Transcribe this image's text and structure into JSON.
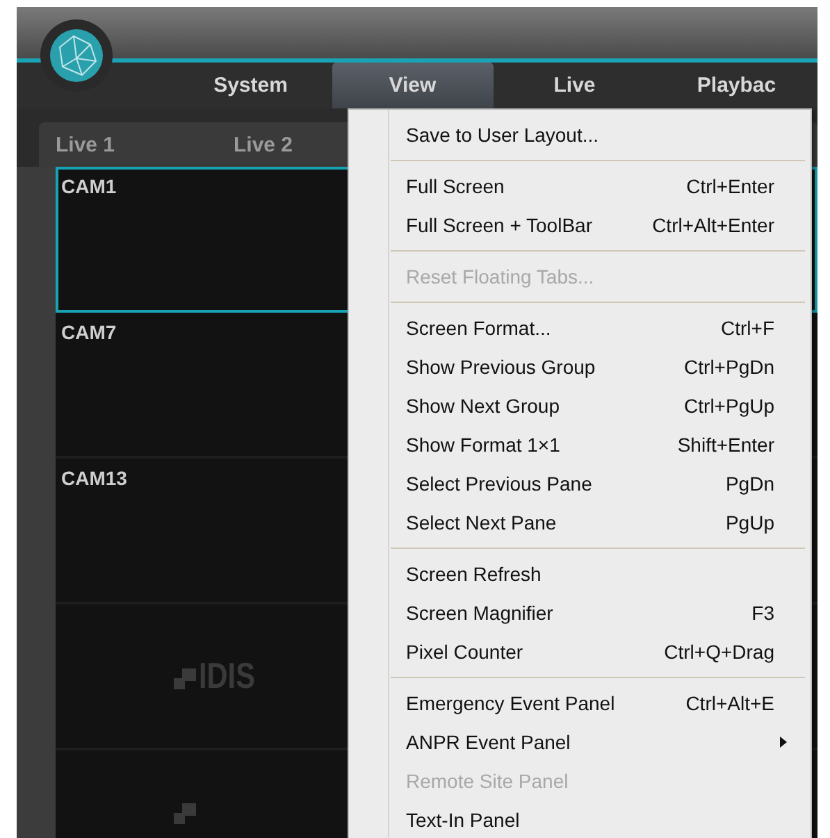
{
  "menubar": [
    {
      "label": "System",
      "selected": false
    },
    {
      "label": "View",
      "selected": true
    },
    {
      "label": "Live",
      "selected": false
    },
    {
      "label": "Playbac",
      "selected": false
    }
  ],
  "live_tabs": [
    {
      "label": "Live 1",
      "selected": false
    },
    {
      "label": "Live 2",
      "selected": false
    }
  ],
  "panes": [
    {
      "kind": "camera",
      "label": "CAM1",
      "selected": true
    },
    {
      "kind": "camera",
      "label": "CAM7",
      "selected": false
    },
    {
      "kind": "camera",
      "label": "CAM13",
      "selected": false
    },
    {
      "kind": "logo",
      "label": "IDIS",
      "selected": false
    },
    {
      "kind": "logo",
      "selected": false
    }
  ],
  "view_menu": [
    {
      "kind": "item",
      "label": "Save to User Layout...",
      "disabled": false
    },
    {
      "kind": "separator"
    },
    {
      "kind": "item",
      "label": "Full Screen",
      "shortcut": "Ctrl+Enter",
      "disabled": false
    },
    {
      "kind": "item",
      "label": "Full Screen + ToolBar",
      "shortcut": "Ctrl+Alt+Enter",
      "disabled": false
    },
    {
      "kind": "separator"
    },
    {
      "kind": "item",
      "label": "Reset Floating Tabs...",
      "disabled": true
    },
    {
      "kind": "separator"
    },
    {
      "kind": "item",
      "label": "Screen Format...",
      "shortcut": "Ctrl+F",
      "disabled": false
    },
    {
      "kind": "item",
      "label": "Show Previous Group",
      "shortcut": "Ctrl+PgDn",
      "disabled": false
    },
    {
      "kind": "item",
      "label": "Show Next Group",
      "shortcut": "Ctrl+PgUp",
      "disabled": false
    },
    {
      "kind": "item",
      "label": "Show Format 1×1",
      "shortcut": "Shift+Enter",
      "disabled": false
    },
    {
      "kind": "item",
      "label": "Select Previous Pane",
      "shortcut": "PgDn",
      "disabled": false
    },
    {
      "kind": "item",
      "label": "Select Next Pane",
      "shortcut": "PgUp",
      "disabled": false
    },
    {
      "kind": "separator"
    },
    {
      "kind": "item",
      "label": "Screen Refresh",
      "disabled": false
    },
    {
      "kind": "item",
      "label": "Screen Magnifier",
      "shortcut": "F3",
      "disabled": false
    },
    {
      "kind": "item",
      "label": "Pixel Counter",
      "shortcut": "Ctrl+Q+Drag",
      "disabled": false
    },
    {
      "kind": "separator"
    },
    {
      "kind": "item",
      "label": "Emergency Event Panel",
      "shortcut": "Ctrl+Alt+E",
      "disabled": false
    },
    {
      "kind": "item",
      "label": "ANPR Event Panel",
      "submenu": true,
      "disabled": false
    },
    {
      "kind": "item",
      "label": "Remote Site Panel",
      "disabled": true
    },
    {
      "kind": "item",
      "label": "Text-In Panel",
      "disabled": false
    }
  ]
}
